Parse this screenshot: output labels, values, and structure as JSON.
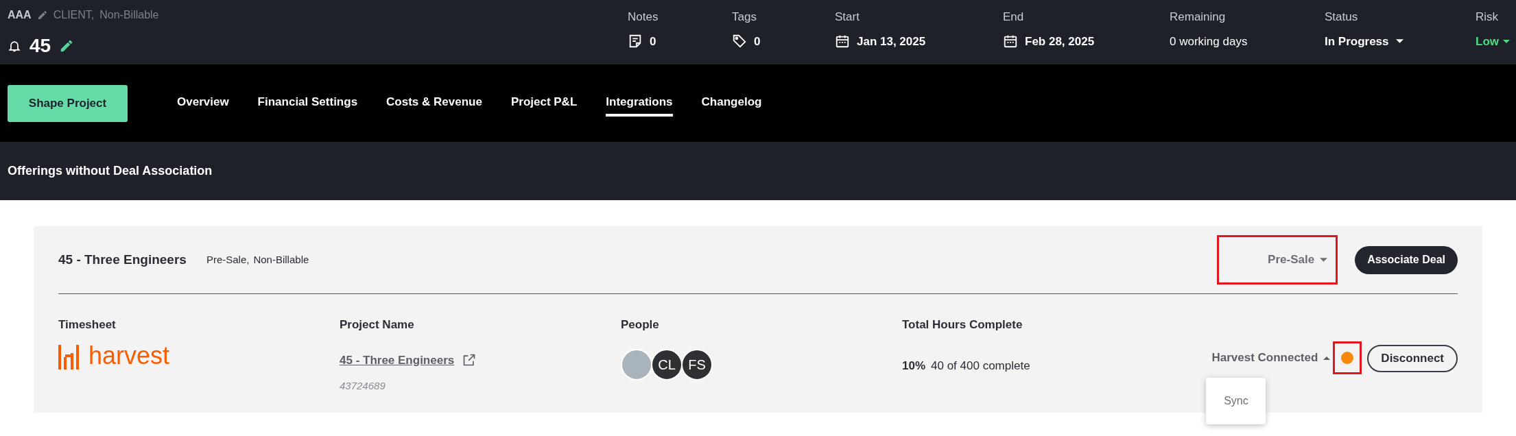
{
  "header": {
    "client": "AAA",
    "client_type": "CLIENT,",
    "billing": "Non-Billable",
    "project_number": "45",
    "stats": [
      {
        "kind": "notes",
        "label": "Notes",
        "value": "0"
      },
      {
        "kind": "tags",
        "label": "Tags",
        "value": "0"
      },
      {
        "kind": "date",
        "label": "Start",
        "value": "Jan 13, 2025"
      },
      {
        "kind": "date",
        "label": "End",
        "value": "Feb 28, 2025"
      },
      {
        "kind": "text",
        "label": "Remaining",
        "value": "0 working days"
      },
      {
        "kind": "dropdown",
        "label": "Status",
        "value": "In Progress"
      },
      {
        "kind": "risk",
        "label": "Risk",
        "value": "Low",
        "color": "#4ade80"
      }
    ]
  },
  "nav": {
    "action": "Shape Project",
    "tabs": [
      {
        "label": "Overview",
        "selected": false
      },
      {
        "label": "Financial Settings",
        "selected": false
      },
      {
        "label": "Costs & Revenue",
        "selected": false
      },
      {
        "label": "Project P&L",
        "selected": false
      },
      {
        "label": "Integrations",
        "selected": true
      },
      {
        "label": "Changelog",
        "selected": false
      }
    ]
  },
  "section_title": "Offerings without Deal Association",
  "offering": {
    "name": "45 - Three Engineers",
    "type": "Pre-Sale,",
    "billing": "Non-Billable",
    "stage": "Pre-Sale",
    "associate": "Associate Deal",
    "columns": [
      "Timesheet",
      "Project Name",
      "People",
      "Total Hours Complete"
    ],
    "timesheet_logo": "harvest",
    "project_name": "45 - Three Engineers",
    "project_id": "43724689",
    "people": [
      {
        "kind": "photo"
      },
      {
        "kind": "initials",
        "initials": "CL"
      },
      {
        "kind": "initials",
        "initials": "FS"
      }
    ],
    "percent": "10%",
    "hours": "40 of 400 complete",
    "connection": {
      "label": "Harvest Connected",
      "expanded": true,
      "color": "#f7890c",
      "menu": [
        "Sync"
      ]
    },
    "disconnect": "Disconnect"
  }
}
